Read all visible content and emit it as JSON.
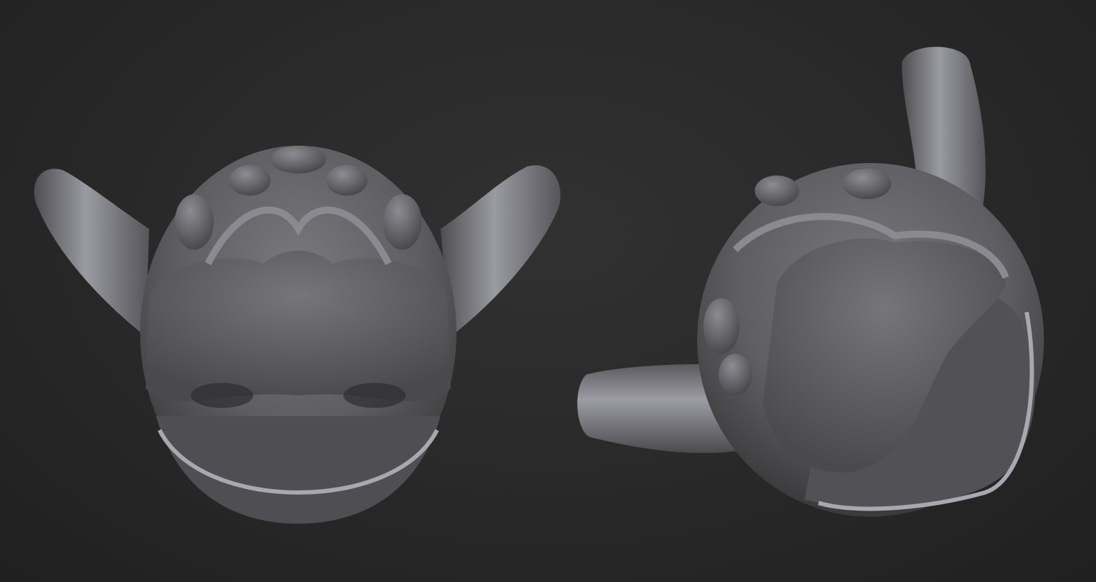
{
  "scene": {
    "background_color": "#2a2a2a",
    "material_color": "#6e6e72",
    "highlight_color": "#b8b8be",
    "shadow_color": "#2e2e30",
    "views": [
      {
        "name": "front-view"
      },
      {
        "name": "three-quarter-view"
      }
    ]
  }
}
